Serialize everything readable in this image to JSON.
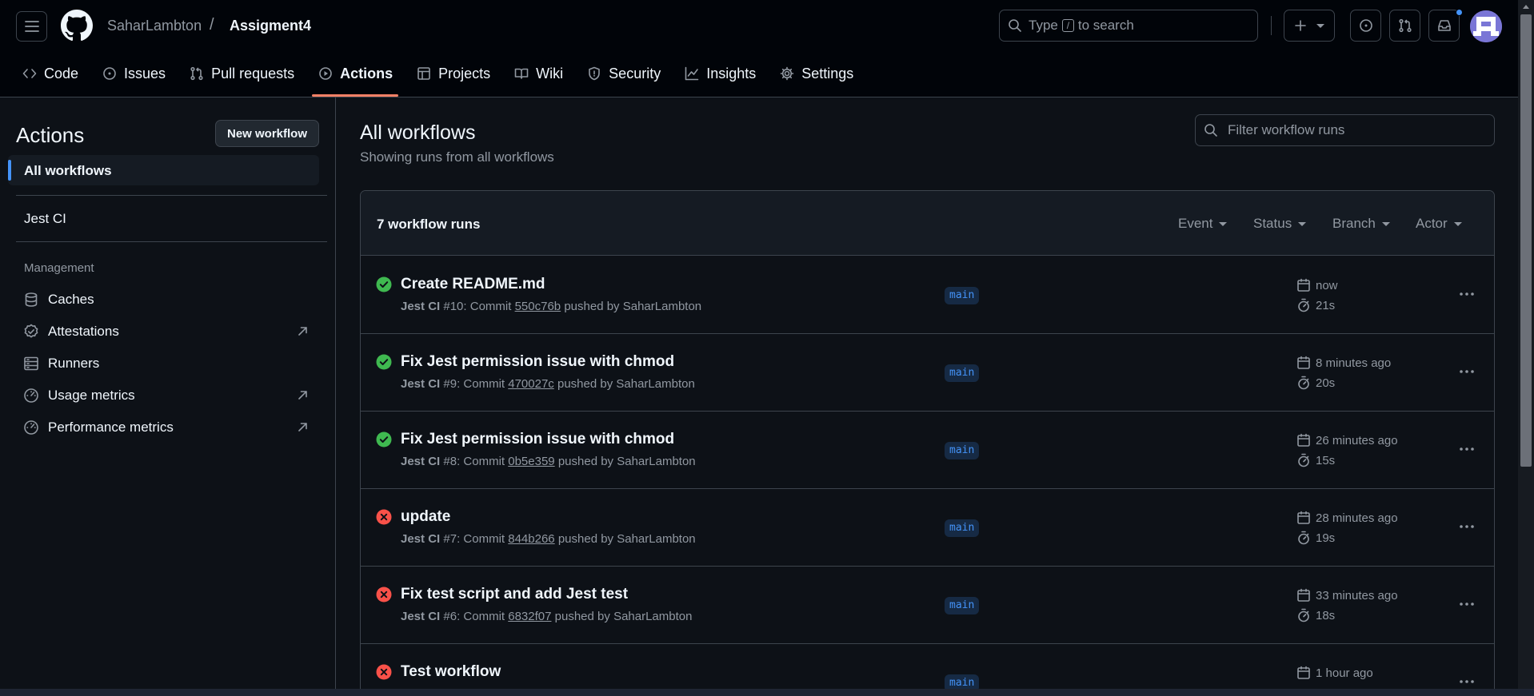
{
  "repo": {
    "owner": "SaharLambton",
    "separator": "/",
    "name": "Assigment4"
  },
  "search": {
    "prefix": "Type",
    "key": "/",
    "suffix": "to search"
  },
  "tabs": [
    {
      "label": "Code",
      "icon": "code-icon"
    },
    {
      "label": "Issues",
      "icon": "issue-opened-icon"
    },
    {
      "label": "Pull requests",
      "icon": "git-pull-request-icon"
    },
    {
      "label": "Actions",
      "icon": "play-icon",
      "active": true
    },
    {
      "label": "Projects",
      "icon": "table-icon"
    },
    {
      "label": "Wiki",
      "icon": "book-icon"
    },
    {
      "label": "Security",
      "icon": "shield-icon"
    },
    {
      "label": "Insights",
      "icon": "graph-icon"
    },
    {
      "label": "Settings",
      "icon": "gear-icon"
    }
  ],
  "sidebar": {
    "title": "Actions",
    "new_workflow": "New workflow",
    "all_workflows": "All workflows",
    "workflows": [
      "Jest CI"
    ],
    "management_heading": "Management",
    "management": [
      {
        "label": "Caches",
        "icon": "database-icon",
        "external": false
      },
      {
        "label": "Attestations",
        "icon": "verified-icon",
        "external": true
      },
      {
        "label": "Runners",
        "icon": "server-icon",
        "external": false
      },
      {
        "label": "Usage metrics",
        "icon": "meter-icon",
        "external": true
      },
      {
        "label": "Performance metrics",
        "icon": "meter-icon",
        "external": true
      }
    ]
  },
  "main": {
    "title": "All workflows",
    "subtitle": "Showing runs from all workflows",
    "filter_placeholder": "Filter workflow runs",
    "run_count": "7 workflow runs",
    "filters": [
      "Event",
      "Status",
      "Branch",
      "Actor"
    ]
  },
  "runs": [
    {
      "title": "Create README.md",
      "workflow": "Jest CI",
      "number": "#10",
      "commit": "550c76b",
      "actor": "SaharLambton",
      "branch": "main",
      "when": "now",
      "duration": "21s",
      "status": "success"
    },
    {
      "title": "Fix Jest permission issue with chmod",
      "workflow": "Jest CI",
      "number": "#9",
      "commit": "470027c",
      "actor": "SaharLambton",
      "branch": "main",
      "when": "8 minutes ago",
      "duration": "20s",
      "status": "success"
    },
    {
      "title": "Fix Jest permission issue with chmod",
      "workflow": "Jest CI",
      "number": "#8",
      "commit": "0b5e359",
      "actor": "SaharLambton",
      "branch": "main",
      "when": "26 minutes ago",
      "duration": "15s",
      "status": "success"
    },
    {
      "title": "update",
      "workflow": "Jest CI",
      "number": "#7",
      "commit": "844b266",
      "actor": "SaharLambton",
      "branch": "main",
      "when": "28 minutes ago",
      "duration": "19s",
      "status": "failure"
    },
    {
      "title": "Fix test script and add Jest test",
      "workflow": "Jest CI",
      "number": "#6",
      "commit": "6832f07",
      "actor": "SaharLambton",
      "branch": "main",
      "when": "33 minutes ago",
      "duration": "18s",
      "status": "failure"
    },
    {
      "title": "Test workflow",
      "workflow": "",
      "number": "",
      "commit": "",
      "actor": "",
      "branch": "main",
      "when": "1 hour ago",
      "duration": "",
      "status": "failure"
    }
  ],
  "labels": {
    "commit": "Commit",
    "pushed_by": "pushed by"
  },
  "colors": {
    "success": "#3fb950",
    "failure": "#f85149",
    "accent": "#4493f8",
    "tab_underline": "#f78166"
  }
}
